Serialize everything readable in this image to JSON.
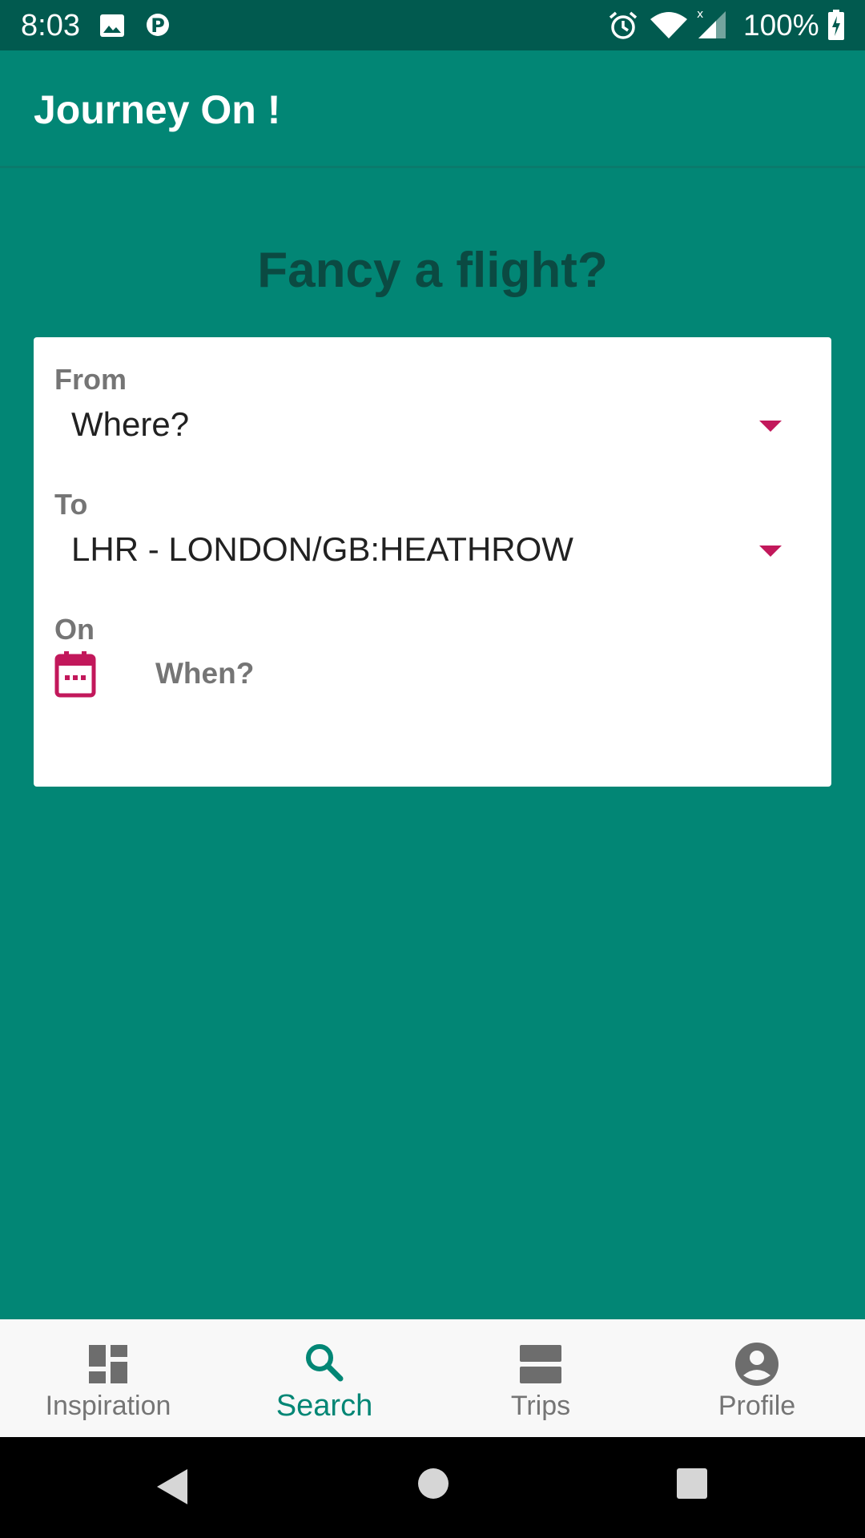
{
  "status_bar": {
    "time": "8:03",
    "battery": "100%",
    "icons": [
      "image-icon",
      "parking-icon",
      "alarm-icon",
      "wifi-icon",
      "cell-signal-icon",
      "battery-charging-icon"
    ]
  },
  "app_bar": {
    "title": "Journey On !"
  },
  "headline": "Fancy a flight?",
  "search_form": {
    "from": {
      "label": "From",
      "value": "Where?"
    },
    "to": {
      "label": "To",
      "value": "LHR - LONDON/GB:HEATHROW"
    },
    "on": {
      "label": "On",
      "value": "When?"
    }
  },
  "bottom_nav": {
    "items": [
      {
        "label": "Inspiration",
        "icon": "dashboard-icon",
        "active": false
      },
      {
        "label": "Search",
        "icon": "search-icon",
        "active": true
      },
      {
        "label": "Trips",
        "icon": "trips-icon",
        "active": false
      },
      {
        "label": "Profile",
        "icon": "account-circle-icon",
        "active": false
      }
    ]
  },
  "system_nav": {
    "buttons": [
      "back-icon",
      "home-icon",
      "recents-icon"
    ]
  },
  "colors": {
    "primary": "#028675",
    "primary_dark": "#015a4f",
    "headline": "#0b4a42",
    "accent": "#c2185b",
    "nav_inactive": "#757575"
  }
}
